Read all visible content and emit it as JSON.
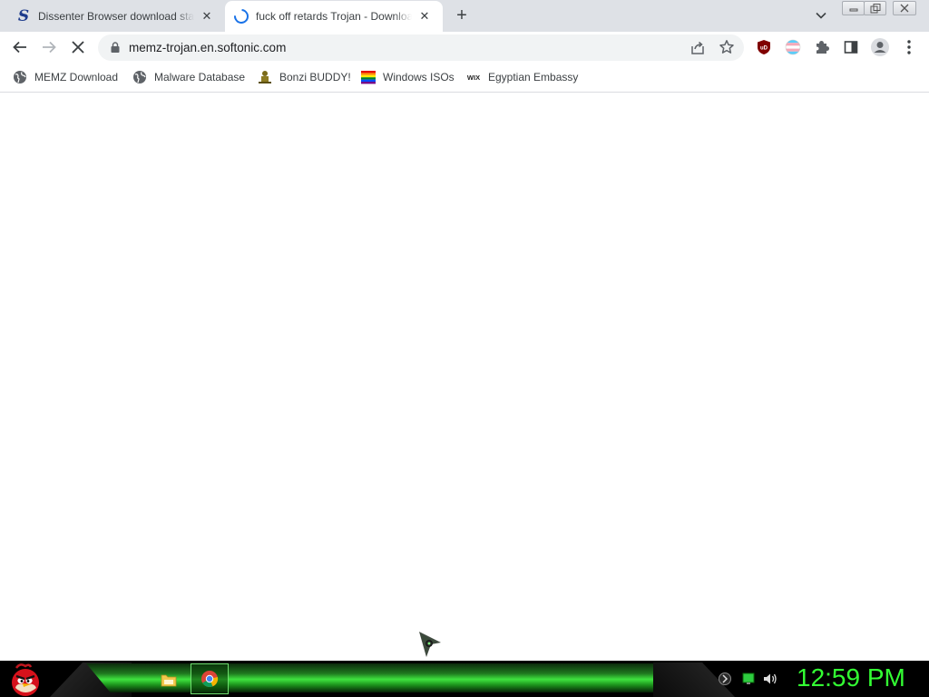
{
  "tabs": [
    {
      "title": "Dissenter Browser download standalone installer",
      "favicon": "softonic-s-icon",
      "active": false
    },
    {
      "title": "fuck off retards Trojan - Download",
      "favicon": "loading-spinner-icon",
      "active": true
    }
  ],
  "toolbar": {
    "url": "memz-trojan.en.softonic.com"
  },
  "bookmarks": [
    {
      "label": "MEMZ Download",
      "icon": "globe-icon"
    },
    {
      "label": "Malware Database",
      "icon": "globe-icon"
    },
    {
      "label": "Bonzi BUDDY!",
      "icon": "bonzi-icon"
    },
    {
      "label": "Windows ISOs",
      "icon": "rainbow-flag-icon"
    },
    {
      "label": "Egyptian Embassy",
      "icon": "wix-icon"
    }
  ],
  "taskbar": {
    "clock": "12:59 PM",
    "accent_color": "#33ff33"
  },
  "colors": {
    "tabstrip": "#dee1e6",
    "omnibox": "#f1f3f4",
    "spinner": "#1a73e8"
  }
}
